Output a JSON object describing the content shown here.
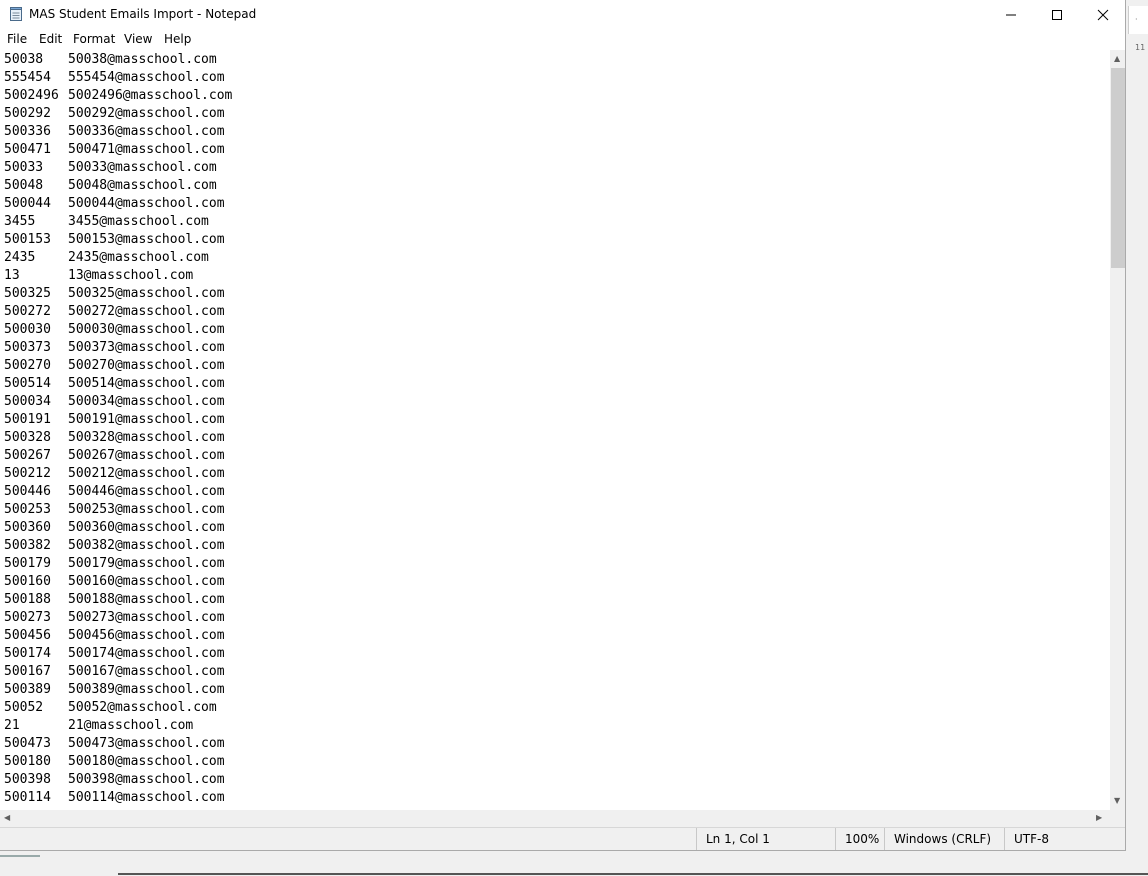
{
  "window": {
    "title": "MAS Student Emails Import - Notepad",
    "icon": "notepad-icon"
  },
  "menu": [
    "File",
    "Edit",
    "Format",
    "View",
    "Help"
  ],
  "document": {
    "lines": [
      [
        "50038",
        "50038@masschool.com"
      ],
      [
        "555454",
        "555454@masschool.com"
      ],
      [
        "5002496",
        "5002496@masschool.com"
      ],
      [
        "500292",
        "500292@masschool.com"
      ],
      [
        "500336",
        "500336@masschool.com"
      ],
      [
        "500471",
        "500471@masschool.com"
      ],
      [
        "50033",
        "50033@masschool.com"
      ],
      [
        "50048",
        "50048@masschool.com"
      ],
      [
        "500044",
        "500044@masschool.com"
      ],
      [
        "3455",
        "3455@masschool.com"
      ],
      [
        "500153",
        "500153@masschool.com"
      ],
      [
        "2435",
        "2435@masschool.com"
      ],
      [
        "13",
        "13@masschool.com"
      ],
      [
        "500325",
        "500325@masschool.com"
      ],
      [
        "500272",
        "500272@masschool.com"
      ],
      [
        "500030",
        "500030@masschool.com"
      ],
      [
        "500373",
        "500373@masschool.com"
      ],
      [
        "500270",
        "500270@masschool.com"
      ],
      [
        "500514",
        "500514@masschool.com"
      ],
      [
        "500034",
        "500034@masschool.com"
      ],
      [
        "500191",
        "500191@masschool.com"
      ],
      [
        "500328",
        "500328@masschool.com"
      ],
      [
        "500267",
        "500267@masschool.com"
      ],
      [
        "500212",
        "500212@masschool.com"
      ],
      [
        "500446",
        "500446@masschool.com"
      ],
      [
        "500253",
        "500253@masschool.com"
      ],
      [
        "500360",
        "500360@masschool.com"
      ],
      [
        "500382",
        "500382@masschool.com"
      ],
      [
        "500179",
        "500179@masschool.com"
      ],
      [
        "500160",
        "500160@masschool.com"
      ],
      [
        "500188",
        "500188@masschool.com"
      ],
      [
        "500273",
        "500273@masschool.com"
      ],
      [
        "500456",
        "500456@masschool.com"
      ],
      [
        "500174",
        "500174@masschool.com"
      ],
      [
        "500167",
        "500167@masschool.com"
      ],
      [
        "500389",
        "500389@masschool.com"
      ],
      [
        "50052",
        "50052@masschool.com"
      ],
      [
        "21",
        "21@masschool.com"
      ],
      [
        "500473",
        "500473@masschool.com"
      ],
      [
        "500180",
        "500180@masschool.com"
      ],
      [
        "500398",
        "500398@masschool.com"
      ],
      [
        "500114",
        "500114@masschool.com"
      ]
    ]
  },
  "status": {
    "position": "Ln 1, Col 1",
    "zoom": "100%",
    "line_endings": "Windows (CRLF)",
    "encoding": "UTF-8"
  },
  "background_sliver": "· 11",
  "colors": {
    "window_bg": "#ffffff",
    "chrome_bg": "#f0f0f0",
    "scroll_thumb": "#cdcdcd"
  }
}
